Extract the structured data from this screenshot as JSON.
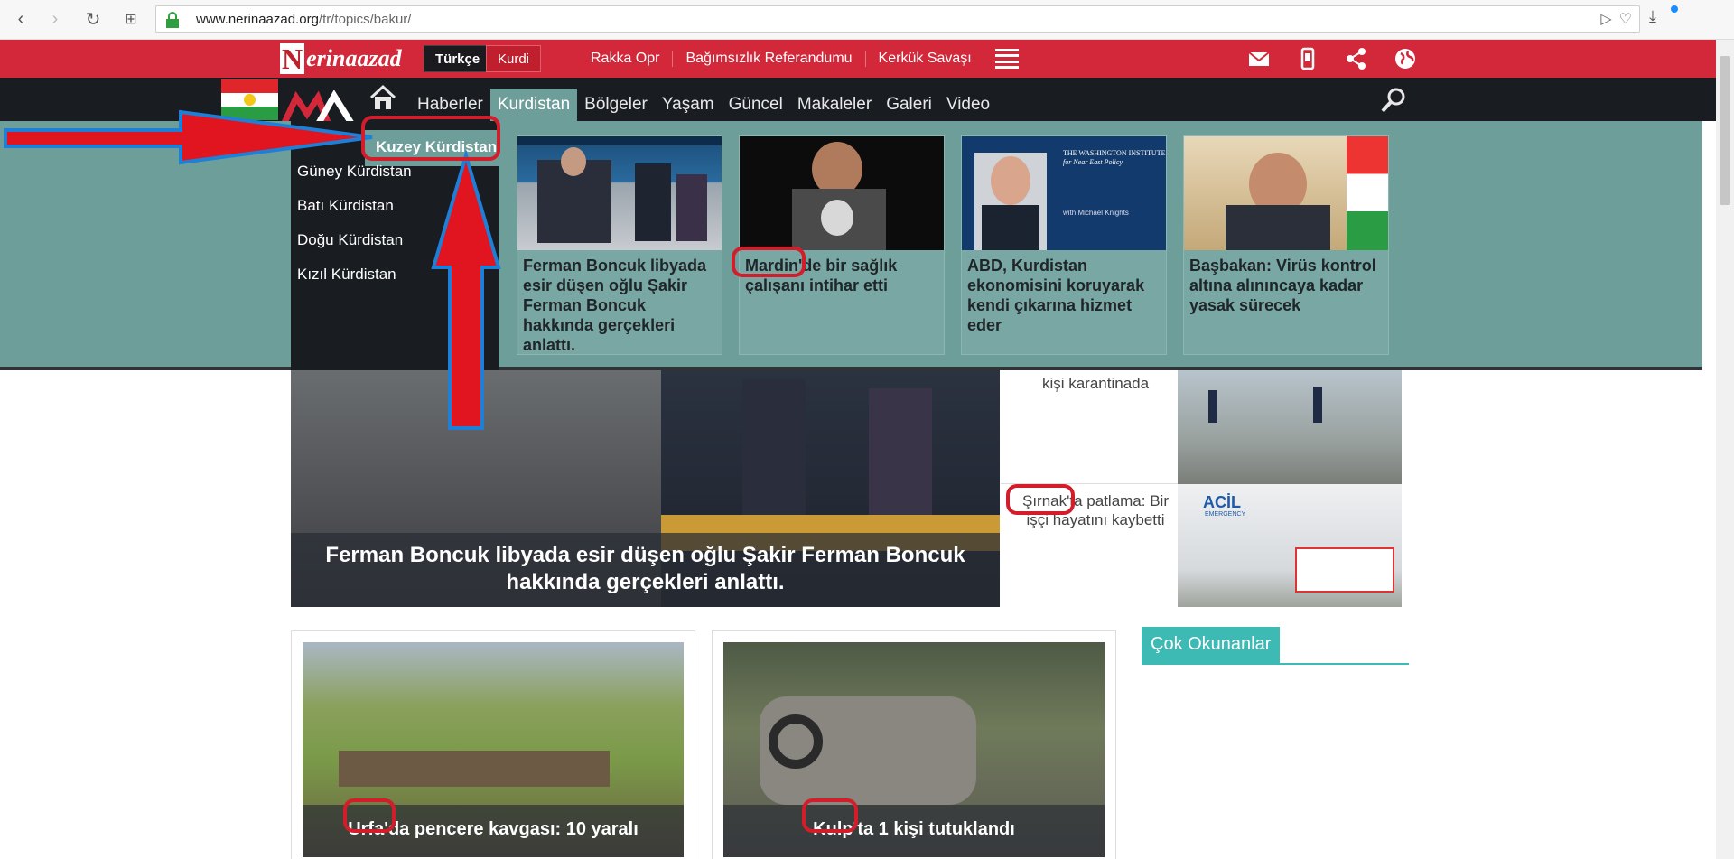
{
  "browser": {
    "url_domain": "www.nerinaazad.org",
    "url_path": "/tr/topics/bakur/"
  },
  "site": {
    "logo_letter": "N",
    "logo_rest": "erinaazad",
    "languages": [
      {
        "label": "Türkçe",
        "active": true
      },
      {
        "label": "Kurdi",
        "active": false
      }
    ],
    "top_links": [
      "Rakka Opr",
      "Bağımsızlık Referandumu",
      "Kerkük Savaşı"
    ],
    "nav_items": [
      {
        "label": "Haberler",
        "active": false
      },
      {
        "label": "Kurdistan",
        "active": true
      },
      {
        "label": "Bölgeler",
        "active": false
      },
      {
        "label": "Yaşam",
        "active": false
      },
      {
        "label": "Güncel",
        "active": false
      },
      {
        "label": "Makaleler",
        "active": false
      },
      {
        "label": "Galeri",
        "active": false
      },
      {
        "label": "Video",
        "active": false
      }
    ]
  },
  "submenu": {
    "items": [
      "Kuzey Kürdistan",
      "Güney Kürdistan",
      "Batı Kürdistan",
      "Doğu Kürdistan",
      "Kızıl Kürdistan"
    ]
  },
  "menu_cards": [
    {
      "title": "Ferman Boncuk libyada esir düşen oğlu Şakir Ferman Boncuk hakkında gerçekleri anlattı."
    },
    {
      "title": "Mardin'de bir sağlık çalışanı intihar etti"
    },
    {
      "title": "ABD, Kurdistan ekonomisini koruyarak kendi çıkarına hizmet eder",
      "thumb_text_1": "THE WASHINGTON INSTITUTE",
      "thumb_text_2": "for Near East Policy",
      "thumb_text_3": "with Michael Knights"
    },
    {
      "title": "Başbakan: Virüs kontrol altına alınıncaya kadar yasak sürecek"
    }
  ],
  "hero": {
    "caption": "Ferman Boncuk libyada esir düşen oğlu Şakir Ferman Boncuk hakkında gerçekleri anlattı."
  },
  "side_news": [
    {
      "text": "kişi karantinada"
    },
    {
      "text": "Şırnak'ta patlama: Bir işçi hayatını kaybetti",
      "sign": "ACİL",
      "sign_sub": "EMERGENCY"
    }
  ],
  "news": [
    {
      "caption": "Urfa'da pencere kavgası: 10 yaralı"
    },
    {
      "caption": "Kulp'ta 1 kişi tutuklandı"
    }
  ],
  "most_read": "Çok Okunanlar",
  "colors": {
    "brand_red": "#d2283a",
    "nav_dark": "#191c21",
    "menu_teal": "#6e9e9a",
    "accent_teal": "#3dbab4",
    "annotation_red": "#d31d2a",
    "annotation_blue": "#1e7fd6"
  }
}
